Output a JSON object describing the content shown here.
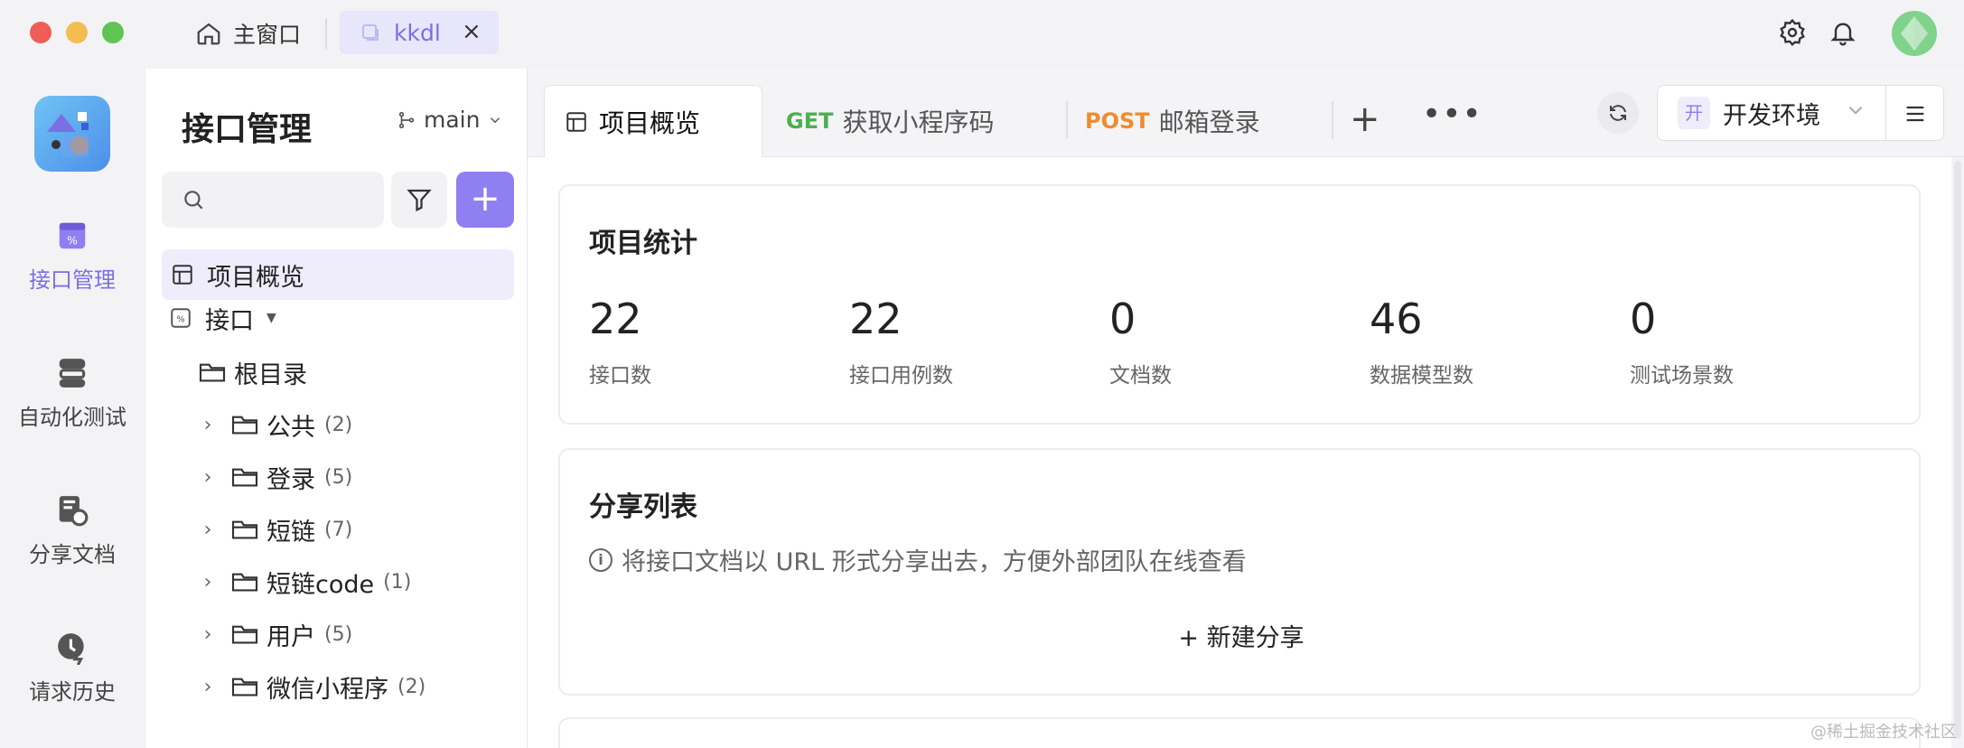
{
  "titlebar": {
    "home_tab_label": "主窗口",
    "active_tab_label": "kkdl",
    "active_tab_close": "×"
  },
  "rail": {
    "items": [
      {
        "label": "接口管理",
        "icon": "api-management-icon",
        "active": true
      },
      {
        "label": "自动化测试",
        "icon": "automation-test-icon",
        "active": false
      },
      {
        "label": "分享文档",
        "icon": "share-doc-icon",
        "active": false
      },
      {
        "label": "请求历史",
        "icon": "history-icon",
        "active": false
      }
    ]
  },
  "sidebar": {
    "title": "接口管理",
    "branch": "main",
    "add_button": "+",
    "overview_label": "项目概览",
    "api_group_label": "接口",
    "root_label": "根目录",
    "folders": [
      {
        "name": "公共",
        "count": "(2)"
      },
      {
        "name": "登录",
        "count": "(5)"
      },
      {
        "name": "短链",
        "count": "(7)"
      },
      {
        "name": "短链code",
        "count": "(1)"
      },
      {
        "name": "用户",
        "count": "(5)"
      },
      {
        "name": "微信小程序",
        "count": "(2)"
      }
    ]
  },
  "main": {
    "tabs": [
      {
        "label": "项目概览"
      },
      {
        "method": "GET",
        "label": "获取小程序码"
      },
      {
        "method": "POST",
        "label": "邮箱登录"
      }
    ],
    "plus": "+",
    "more": "•••",
    "env_badge": "开",
    "env_label": "开发环境",
    "stats_card": {
      "title": "项目统计",
      "stats": [
        {
          "value": "22",
          "label": "接口数"
        },
        {
          "value": "22",
          "label": "接口用例数"
        },
        {
          "value": "0",
          "label": "文档数"
        },
        {
          "value": "46",
          "label": "数据模型数"
        },
        {
          "value": "0",
          "label": "测试场景数"
        }
      ]
    },
    "share_card": {
      "title": "分享列表",
      "info": "将接口文档以 URL 形式分享出去，方便外部团队在线查看",
      "new_share": "+ 新建分享"
    }
  },
  "watermark": "@稀土掘金技术社区",
  "colors": {
    "accent": "#8f7ff0",
    "get": "#4caf50",
    "post": "#f08c2e"
  }
}
